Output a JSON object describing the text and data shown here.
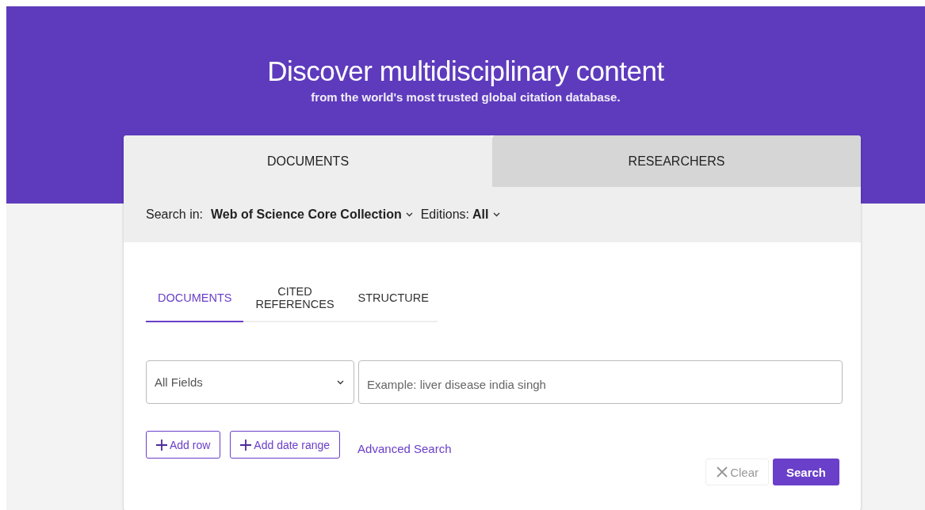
{
  "hero": {
    "title": "Discover multidisciplinary content",
    "subtitle": "from the world's most trusted global citation database."
  },
  "main_tabs": [
    {
      "label": "DOCUMENTS",
      "selected": true
    },
    {
      "label": "RESEARCHERS",
      "selected": false
    }
  ],
  "search_in": {
    "label": "Search in:",
    "collection": "Web of Science Core Collection",
    "editions_label": "Editions:",
    "editions": "All"
  },
  "sub_tabs": [
    {
      "label": "DOCUMENTS",
      "selected": true
    },
    {
      "label": "CITED REFERENCES",
      "selected": false
    },
    {
      "label": "STRUCTURE",
      "selected": false
    }
  ],
  "field_select": {
    "value": "All Fields"
  },
  "query": {
    "placeholder": "Example: liver disease india singh"
  },
  "add_buttons": [
    {
      "label": "Add row"
    },
    {
      "label": "Add date range"
    }
  ],
  "advanced_link": "Advanced Search",
  "clear_button": {
    "label": "Clear",
    "disabled": true
  },
  "search_button": {
    "label": "Search"
  }
}
